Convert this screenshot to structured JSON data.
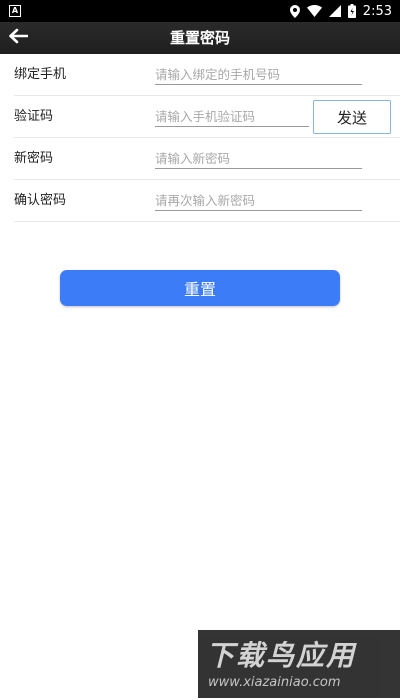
{
  "status_bar": {
    "left_icon": "A",
    "time": "2:53",
    "icons": [
      "location-icon",
      "wifi-icon",
      "signal-icon",
      "battery-icon"
    ]
  },
  "app_bar": {
    "title": "重置密码",
    "back_icon": "back-arrow-icon"
  },
  "form": {
    "phone": {
      "label": "绑定手机",
      "placeholder": "请输入绑定的手机号码",
      "value": ""
    },
    "code": {
      "label": "验证码",
      "placeholder": "请输入手机验证码",
      "value": "",
      "send_label": "发送"
    },
    "new_password": {
      "label": "新密码",
      "placeholder": "请输入新密码",
      "value": ""
    },
    "confirm_password": {
      "label": "确认密码",
      "placeholder": "请再次输入新密码",
      "value": ""
    }
  },
  "reset_button": {
    "label": "重置"
  },
  "colors": {
    "accent": "#3c7cf6",
    "app_bar": "#222222",
    "status_bar": "#000000"
  },
  "watermark": {
    "title": "下载鸟应用",
    "url": "www.xiazainiao.com"
  }
}
